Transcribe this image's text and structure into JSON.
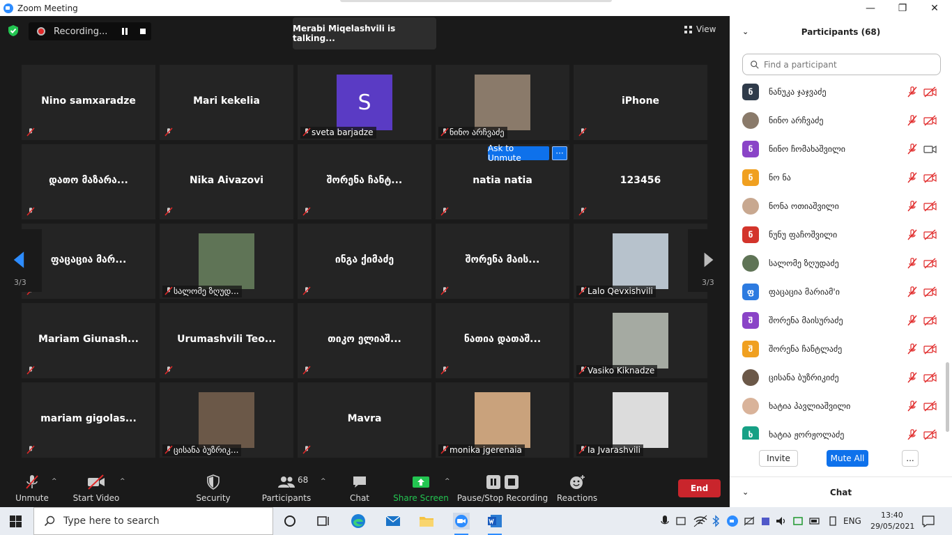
{
  "window": {
    "title": "Zoom Meeting",
    "minimize": "—",
    "maximize": "❐",
    "close": "✕"
  },
  "top": {
    "recording_label": "Recording...",
    "talking": "Merabi Miqelashvili is talking...",
    "view_label": "View"
  },
  "gallery": {
    "page_left": "3/3",
    "page_right": "3/3",
    "ask_unmute": "Ask to Unmute",
    "more": "···",
    "tiles": [
      {
        "name": "Nino  samxaradze",
        "kind": "name"
      },
      {
        "name": "Mari kekelia",
        "kind": "name"
      },
      {
        "name": "sveta barjadze",
        "kind": "letter",
        "letter": "S",
        "color": "#5a3bc4"
      },
      {
        "name": "ნინო არჩვაძე",
        "kind": "photo",
        "photo": "#8a7a6a"
      },
      {
        "name": "iPhone",
        "kind": "name"
      },
      {
        "name": "დათო მაზარა...",
        "kind": "name"
      },
      {
        "name": "Nika Aivazovi",
        "kind": "name"
      },
      {
        "name": "შორენა ჩანტ...",
        "kind": "name"
      },
      {
        "name": "natia natia",
        "kind": "name"
      },
      {
        "name": "123456",
        "kind": "name"
      },
      {
        "name": "ფაცაცია მარ...",
        "kind": "name"
      },
      {
        "name": "სალომე ზღუდ...",
        "kind": "photo",
        "photo": "#5f7456"
      },
      {
        "name": "ინგა ქიმაძე",
        "kind": "name"
      },
      {
        "name": "შორენა მაის...",
        "kind": "name"
      },
      {
        "name": "Lalo Qevxishvili",
        "kind": "photo",
        "photo": "#b7c2cc"
      },
      {
        "name": "Mariam  Giunash...",
        "kind": "name"
      },
      {
        "name": "Urumashvili  Teo...",
        "kind": "name"
      },
      {
        "name": "თიკო ელიაშ...",
        "kind": "name"
      },
      {
        "name": "ნათია დათაშ...",
        "kind": "name"
      },
      {
        "name": "Vasiko Kiknadze",
        "kind": "photo",
        "photo": "#a5aaa2"
      },
      {
        "name": "mariam  gigolas...",
        "kind": "name"
      },
      {
        "name": "ცისანა ბუზრიკ...",
        "kind": "photo",
        "photo": "#6b5848"
      },
      {
        "name": "Mavra",
        "kind": "name"
      },
      {
        "name": "monika jgerenaia",
        "kind": "photo",
        "photo": "#c9a27c"
      },
      {
        "name": "Ia Jvarashvili",
        "kind": "photo",
        "photo": "#dcdcdc"
      }
    ]
  },
  "toolbar": {
    "unmute": "Unmute",
    "start_video": "Start Video",
    "security": "Security",
    "participants": "Participants",
    "participants_count": "68",
    "chat": "Chat",
    "share_screen": "Share Screen",
    "pause_stop_recording": "Pause/Stop Recording",
    "reactions": "Reactions",
    "end": "End",
    "caret": "^"
  },
  "panel": {
    "title": "Participants (68)",
    "chevron": "⌄",
    "search_placeholder": "Find a participant",
    "participants": [
      {
        "name": "ნანუკა ჯაჯვაძე",
        "initial": "ნ",
        "color": "#2f3b4a",
        "photo": false,
        "cam": "off"
      },
      {
        "name": "ნინო არჩვაძე",
        "initial": "",
        "color": "#8a7a6a",
        "photo": true,
        "cam": "off"
      },
      {
        "name": "ნინო ჩომახაშვილი",
        "initial": "ნ",
        "color": "#8a44c7",
        "photo": false,
        "cam": "on"
      },
      {
        "name": "ნო ნა",
        "initial": "ნ",
        "color": "#f0a020",
        "photo": false,
        "cam": "off"
      },
      {
        "name": "ნონა ოთიაშვილი",
        "initial": "",
        "color": "#c8a890",
        "photo": true,
        "cam": "off"
      },
      {
        "name": "ნუნუ ფაჩოშვილი",
        "initial": "ნ",
        "color": "#d3342b",
        "photo": false,
        "cam": "off"
      },
      {
        "name": "სალომე ზღუდაძე",
        "initial": "",
        "color": "#5f7456",
        "photo": true,
        "cam": "off"
      },
      {
        "name": "ფაცაცია მარიამ'ი",
        "initial": "ფ",
        "color": "#2d7be0",
        "photo": false,
        "cam": "off"
      },
      {
        "name": "შორენა მაისურაძე",
        "initial": "შ",
        "color": "#8a44c7",
        "photo": false,
        "cam": "off"
      },
      {
        "name": "შორენა ჩანტლაძე",
        "initial": "შ",
        "color": "#f0a020",
        "photo": false,
        "cam": "off"
      },
      {
        "name": "ცისანა ბუზრიკიძე",
        "initial": "",
        "color": "#6b5848",
        "photo": true,
        "cam": "off"
      },
      {
        "name": "ხატია პავლიაშვილი",
        "initial": "",
        "color": "#d9b39a",
        "photo": true,
        "cam": "off"
      },
      {
        "name": "ხატია ჟორჟოლაძე",
        "initial": "ხ",
        "color": "#16a085",
        "photo": false,
        "cam": "off"
      }
    ],
    "invite": "Invite",
    "mute_all": "Mute All",
    "more": "...",
    "chat_title": "Chat"
  },
  "taskbar": {
    "search_placeholder": "Type here to search",
    "language": "ENG",
    "time": "13:40",
    "date": "29/05/2021"
  },
  "colors": {
    "accent": "#0e71eb",
    "end": "#c9252c",
    "share": "#23c551",
    "muted": "#e02828"
  }
}
